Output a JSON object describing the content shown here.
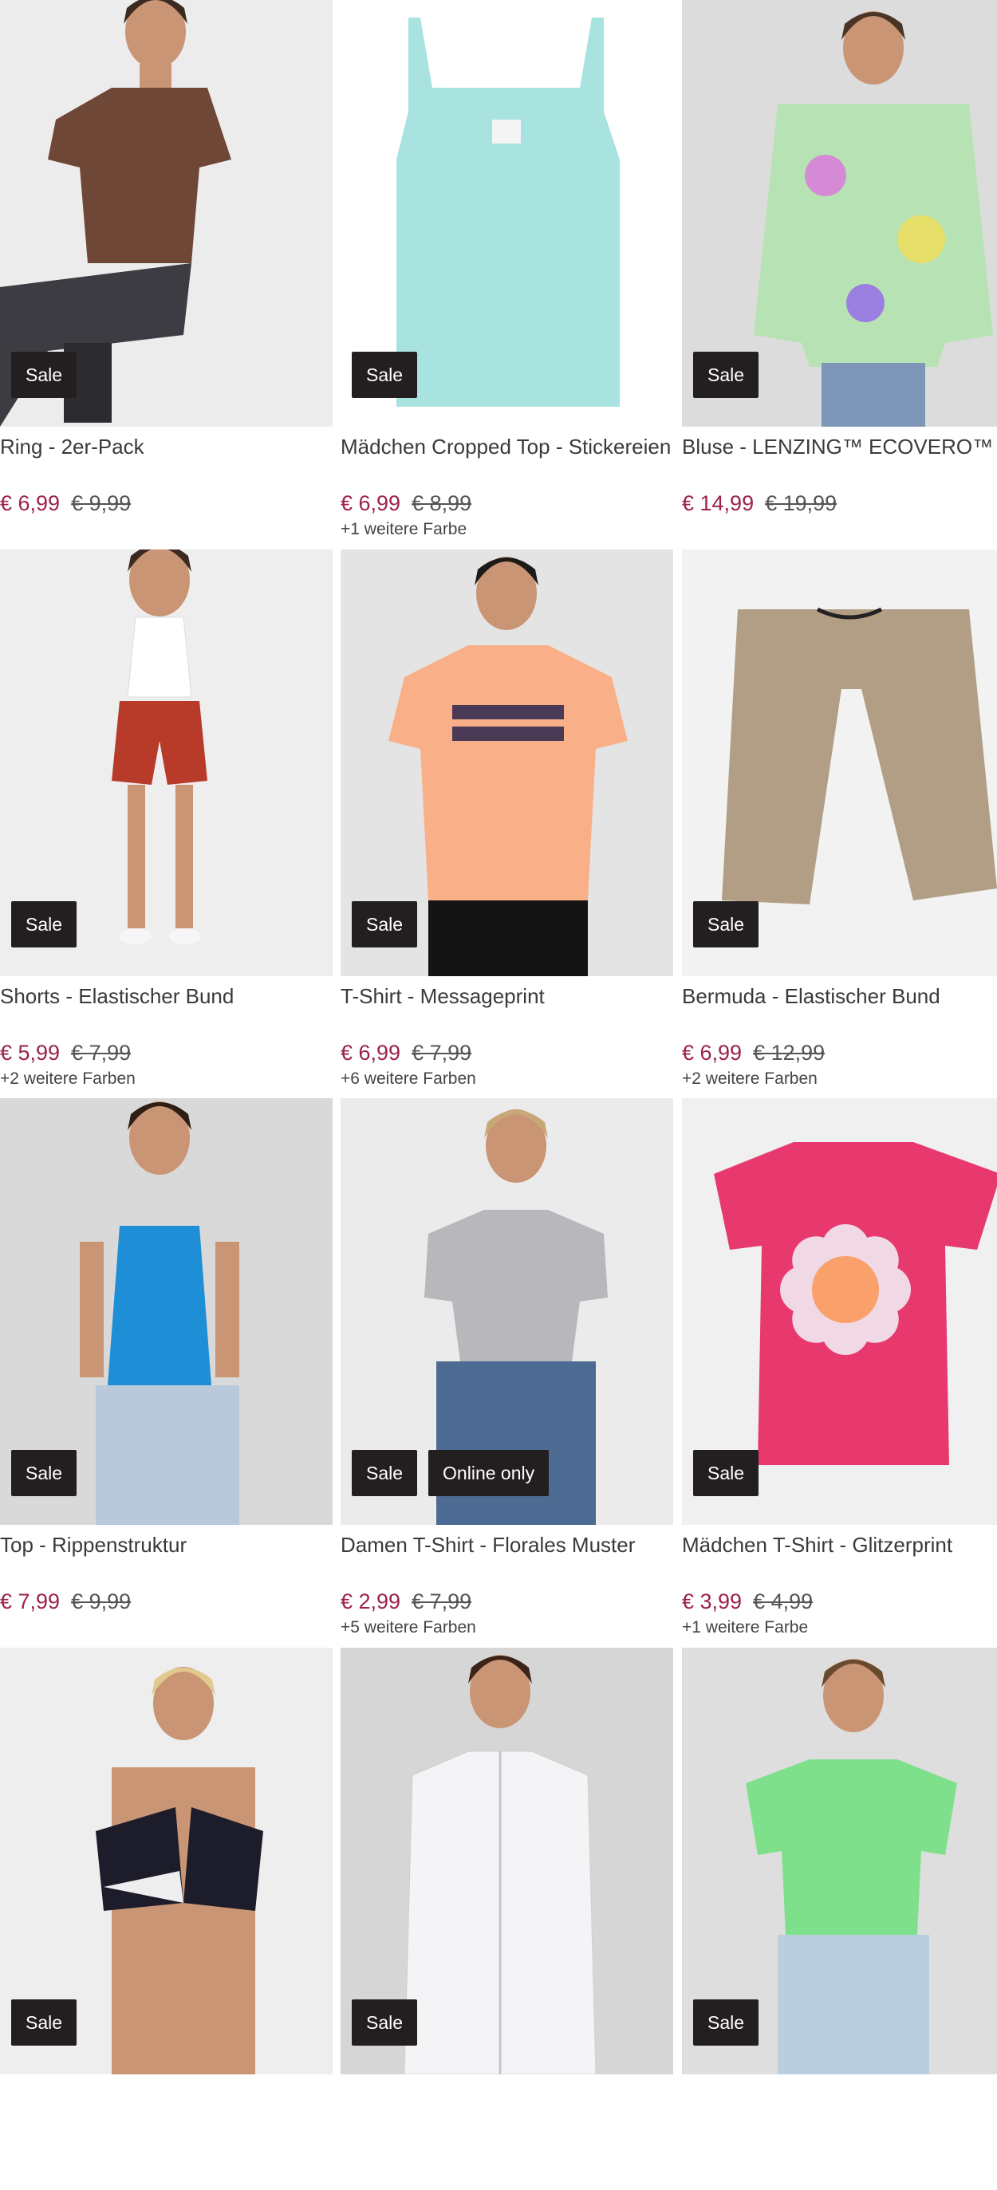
{
  "products": [
    {
      "title": "Ring - 2er-Pack",
      "price": "€ 6,99",
      "old_price": "€ 9,99",
      "colors": "",
      "badges": [
        "Sale"
      ],
      "bg": "#ececec",
      "garment": "#6e4736",
      "kind": "tshirt-man"
    },
    {
      "title": "Mädchen Cropped Top - Stickereien",
      "price": "€ 6,99",
      "old_price": "€ 8,99",
      "colors": "+1 weitere Farbe",
      "badges": [
        "Sale"
      ],
      "bg": "#ffffff",
      "garment": "#a8e3df",
      "kind": "cami"
    },
    {
      "title": "Bluse - LENZING™ ECOVERO™",
      "price": "€ 14,99",
      "old_price": "€ 19,99",
      "colors": "",
      "badges": [
        "Sale"
      ],
      "bg": "#dcdcdc",
      "garment": "#b7e3b4",
      "kind": "blouse-back"
    },
    {
      "title": "Shorts - Elastischer Bund",
      "price": "€ 5,99",
      "old_price": "€ 7,99",
      "colors": "+2 weitere Farben",
      "badges": [
        "Sale"
      ],
      "bg": "#eeeeee",
      "garment": "#b83a28",
      "kind": "woman-shorts"
    },
    {
      "title": "T-Shirt - Messageprint",
      "price": "€ 6,99",
      "old_price": "€ 7,99",
      "colors": "+6 weitere Farben",
      "badges": [
        "Sale"
      ],
      "bg": "#e4e4e4",
      "garment": "#f9b089",
      "kind": "tshirt-print"
    },
    {
      "title": "Bermuda - Elastischer Bund",
      "price": "€ 6,99",
      "old_price": "€ 12,99",
      "colors": "+2 weitere Farben",
      "badges": [
        "Sale"
      ],
      "bg": "#f2f2f2",
      "garment": "#b19e84",
      "kind": "bermuda"
    },
    {
      "title": "Top - Rippenstruktur",
      "price": "€ 7,99",
      "old_price": "€ 9,99",
      "colors": "",
      "badges": [
        "Sale"
      ],
      "bg": "#d9d9d9",
      "garment": "#1e8fd6",
      "kind": "tank-woman"
    },
    {
      "title": "Damen T-Shirt - Florales Muster",
      "price": "€ 2,99",
      "old_price": "€ 7,99",
      "colors": "+5 weitere Farben",
      "badges": [
        "Sale",
        "Online only"
      ],
      "bg": "#ebebeb",
      "garment": "#b8b8bc",
      "kind": "tee-woman"
    },
    {
      "title": "Mädchen T-Shirt - Glitzerprint",
      "price": "€ 3,99",
      "old_price": "€ 4,99",
      "colors": "+1 weitere Farbe",
      "badges": [
        "Sale"
      ],
      "bg": "#f0f0f0",
      "garment": "#e8396e",
      "kind": "tee-flower"
    },
    {
      "title": "",
      "price": "",
      "old_price": "",
      "colors": "",
      "badges": [
        "Sale"
      ],
      "bg": "#eeeeee",
      "garment": "#1c1c2a",
      "kind": "bikini"
    },
    {
      "title": "",
      "price": "",
      "old_price": "",
      "colors": "",
      "badges": [
        "Sale"
      ],
      "bg": "#d6d6d6",
      "garment": "#f4f4f6",
      "kind": "shirt-man"
    },
    {
      "title": "",
      "price": "",
      "old_price": "",
      "colors": "",
      "badges": [
        "Sale"
      ],
      "bg": "#dedede",
      "garment": "#7fe08b",
      "kind": "tee-green"
    }
  ]
}
